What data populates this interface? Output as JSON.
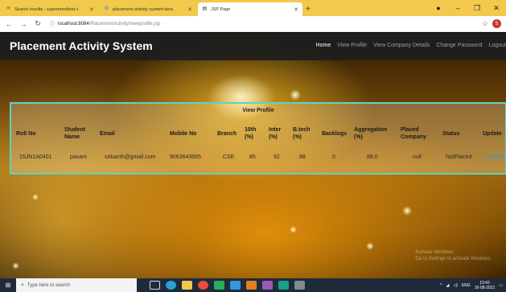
{
  "browser": {
    "tabs": [
      {
        "label": "Search results - supremenfood.c",
        "icon": "mail-favicon"
      },
      {
        "label": "placement activity system itera",
        "icon": "google-favicon"
      },
      {
        "label": "JSP Page",
        "icon": "page-favicon",
        "active": true
      }
    ],
    "url_host": "localhost:8084",
    "url_path": "/PlacementActivity/viewprofile.jsp",
    "profile_initial": "S"
  },
  "app": {
    "brand": "Placement Activity System",
    "nav": [
      "Home",
      "View Profile",
      "View Company Details",
      "Change Password",
      "Logout"
    ],
    "active_nav": "Home"
  },
  "panel": {
    "title": "View Profile",
    "headers": [
      "Roll No",
      "Student Name",
      "Email",
      "Mobile No",
      "Branch",
      "10th (%)",
      "Inter (%)",
      "B.tech (%)",
      "Backlogs",
      "Aggregation (%)",
      "Placed Company",
      "Status",
      "Update"
    ],
    "rows": [
      [
        "15JN1A0401",
        "pavani",
        "srikanth@gmail.com",
        "9063643665",
        "CSE",
        "85",
        "92",
        "88",
        "0",
        "88.0",
        "null",
        "NotPlaced",
        "Update"
      ]
    ]
  },
  "watermark": {
    "line1": "Activate Windows",
    "line2": "Go to Settings to activate Windows."
  },
  "taskbar": {
    "search_placeholder": "Type here to search",
    "time": "10:42",
    "date": "16-08-2021",
    "lang": "ENG"
  },
  "colors": {
    "tab_strip": "#f2c94c",
    "navbar": "#1e1e1e",
    "panel_border": "#5bd4c4",
    "link": "#2a9fd6"
  }
}
